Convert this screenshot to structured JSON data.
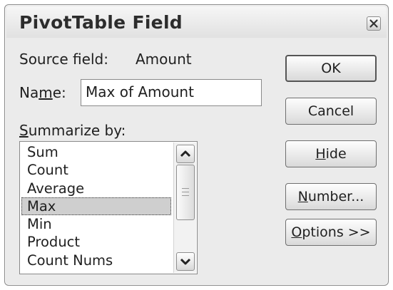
{
  "dialog": {
    "title": "PivotTable Field",
    "close_icon": "close-icon"
  },
  "source_field": {
    "label": "Source field:",
    "value": "Amount"
  },
  "name_field": {
    "label_before": "Na",
    "label_mnemonic": "m",
    "label_after": "e:",
    "value": "Max of Amount"
  },
  "summarize": {
    "label_mnemonic": "S",
    "label_rest": "ummarize by:",
    "items": [
      "Sum",
      "Count",
      "Average",
      "Max",
      "Min",
      "Product",
      "Count Nums"
    ],
    "selected": "Max"
  },
  "buttons": {
    "ok": "OK",
    "cancel": "Cancel",
    "hide_mnemonic": "H",
    "hide_rest": "ide",
    "number_mnemonic": "N",
    "number_rest": "umber...",
    "options_mnemonic": "O",
    "options_rest": "ptions >>"
  }
}
